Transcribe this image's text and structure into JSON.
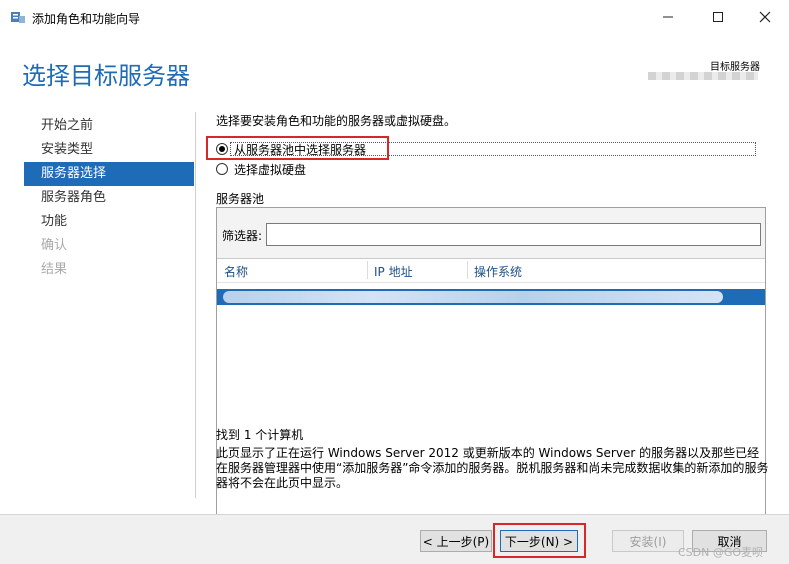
{
  "window": {
    "title": "添加角色和功能向导",
    "min_icon": "minimize-icon",
    "max_icon": "maximize-icon",
    "close_icon": "close-icon"
  },
  "header": {
    "page_title": "选择目标服务器",
    "destination_label": "目标服务器"
  },
  "nav": {
    "items": [
      {
        "label": "开始之前",
        "state": "normal"
      },
      {
        "label": "安装类型",
        "state": "normal"
      },
      {
        "label": "服务器选择",
        "state": "selected"
      },
      {
        "label": "服务器角色",
        "state": "normal"
      },
      {
        "label": "功能",
        "state": "normal"
      },
      {
        "label": "确认",
        "state": "disabled"
      },
      {
        "label": "结果",
        "state": "disabled"
      }
    ]
  },
  "content": {
    "intro": "选择要安装角色和功能的服务器或虚拟硬盘。",
    "options": [
      {
        "label": "从服务器池中选择服务器",
        "checked": true
      },
      {
        "label": "选择虚拟硬盘",
        "checked": false
      }
    ],
    "pool_heading": "服务器池",
    "filter_label": "筛选器:",
    "filter_value": "",
    "columns": [
      "名称",
      "IP 地址",
      "操作系统"
    ],
    "found_text": "找到 1 个计算机",
    "description": "此页显示了正在运行 Windows Server 2012 或更新版本的 Windows Server 的服务器以及那些已经在服务器管理器中使用“添加服务器”命令添加的服务器。脱机服务器和尚未完成数据收集的新添加的服务器将不会在此页中显示。"
  },
  "footer": {
    "prev_label": "< 上一步(P)",
    "next_label": "下一步(N) >",
    "install_label": "安装(I)",
    "cancel_label": "取消"
  },
  "watermark": "CSDN @GO麦呗",
  "colors": {
    "accent": "#1e6bb8",
    "highlight": "#d62828"
  }
}
